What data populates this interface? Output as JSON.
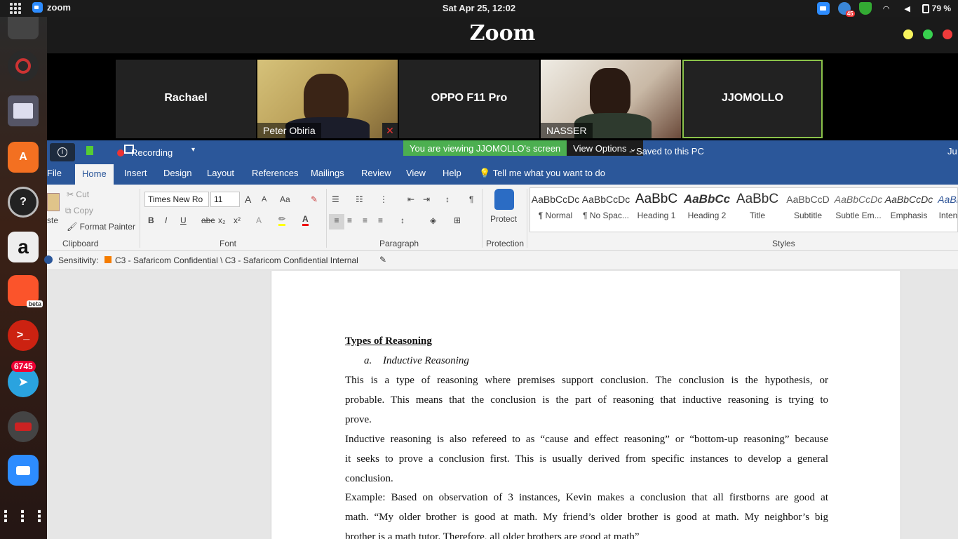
{
  "topbar": {
    "app_name": "zoom",
    "clock": "Sat Apr 25, 12:02",
    "battery": "79 %",
    "notif_count": "45"
  },
  "dock": {
    "telegram_badge": "6745",
    "beta_label": "beta"
  },
  "zoom": {
    "title": "Zoom",
    "participants": [
      {
        "name": "Rachael"
      },
      {
        "name": "Peter Obiria"
      },
      {
        "name": "OPPO F11 Pro"
      },
      {
        "name": "NASSER"
      },
      {
        "name": "JJOMOLLO"
      }
    ],
    "viewing_banner": "You are viewing JJOMOLLO's screen",
    "view_options": "View Options",
    "recording": "Recording"
  },
  "word": {
    "saved": "Saved to this PC",
    "user_fragment": "Ju",
    "tabs": [
      "File",
      "Home",
      "Insert",
      "Design",
      "Layout",
      "References",
      "Mailings",
      "Review",
      "View",
      "Help"
    ],
    "tell_me": "Tell me what you want to do",
    "clipboard": {
      "cut": "Cut",
      "copy": "Copy",
      "format_painter": "Format Painter",
      "paste": "ste",
      "label": "Clipboard"
    },
    "font": {
      "name": "Times New Ro",
      "size": "11",
      "label": "Font"
    },
    "paragraph_label": "Paragraph",
    "protection": {
      "button": "Protect",
      "label": "Protection"
    },
    "styles_label": "Styles",
    "styles": [
      {
        "preview": "AaBbCcDc",
        "label": "¶ Normal"
      },
      {
        "preview": "AaBbCcDc",
        "label": "¶ No Spac..."
      },
      {
        "preview": "AaBbC",
        "label": "Heading 1"
      },
      {
        "preview": "AaBbCc",
        "label": "Heading 2"
      },
      {
        "preview": "AaBbC",
        "label": "Title"
      },
      {
        "preview": "AaBbCcD",
        "label": "Subtitle"
      },
      {
        "preview": "AaBbCcDc",
        "label": "Subtle Em..."
      },
      {
        "preview": "AaBbCcDc",
        "label": "Emphasis"
      },
      {
        "preview": "AaBl",
        "label": "Inten"
      }
    ],
    "sensitivity_label": "Sensitivity:",
    "sensitivity_value": "C3 - Safaricom Confidential \\ C3 - Safaricom Confidential Internal"
  },
  "document": {
    "heading": "Types of Reasoning",
    "sub_marker": "a.",
    "sub_heading": "Inductive Reasoning",
    "p1_lines": [
      "This is a type of reasoning where premises support conclusion. The conclusion is the hypothesis, or",
      "probable. This means that the conclusion is the part of reasoning that inductive reasoning is trying to",
      "prove."
    ],
    "p2_lines": [
      "Inductive reasoning is also refereed to as “cause and effect reasoning” or “bottom-up reasoning” because",
      "it seeks to prove a conclusion first. This is usually derived from specific instances to develop a general",
      "conclusion."
    ],
    "p3_lines": [
      "Example: Based on observation of 3 instances, Kevin makes a conclusion that all firstborns are good at",
      "math. “My older brother is good at math. My friend’s older brother is good at math. My neighbor’s big",
      "brother is a math tutor. Therefore, all older brothers are good at math”"
    ]
  }
}
